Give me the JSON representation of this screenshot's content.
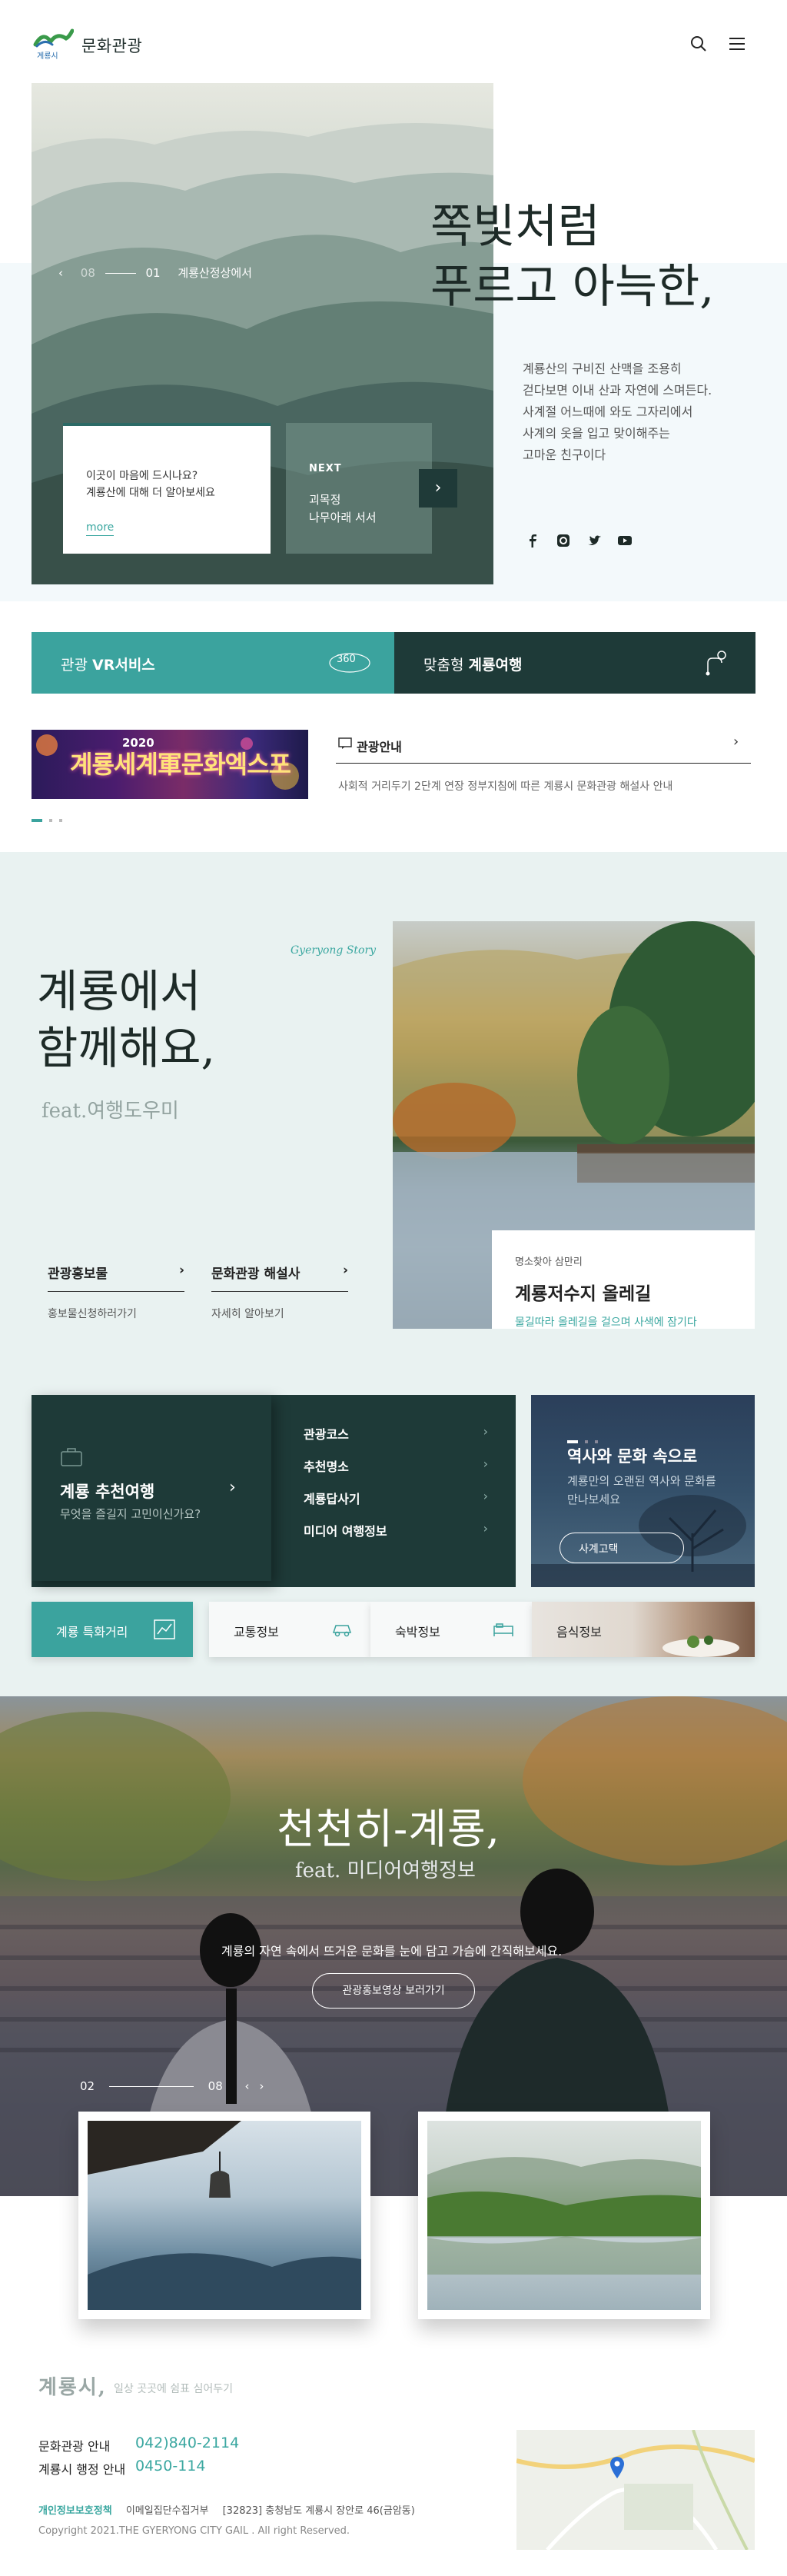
{
  "header": {
    "logo_small": "계룡시",
    "logo_text": "문화관광"
  },
  "hero": {
    "page_current": "08",
    "page_index": "01",
    "slide_title": "계룡산정상에서",
    "card_text_1": "이곳이 마음에 드시나요?",
    "card_text_2": "계룡산에 대해 더 알아보세요",
    "card_more": "more",
    "next_label": "NEXT",
    "next_line_1": "괴목정",
    "next_line_2": "나무아래 서서",
    "title_line_1": "쪽빛처럼",
    "title_line_2": "푸르고 아늑한,",
    "desc": [
      "계룡산의 구비진 산맥을 조용히",
      "걷다보면 이내 산과 자연에 스며든다.",
      "사계절 어느때에 와도 그자리에서",
      "사계의 옷을 입고 맞이해주는",
      "고마운 친구이다"
    ]
  },
  "banners": {
    "vr_prefix": "관광",
    "vr_strong": "VR서비스",
    "vr_badge": "360",
    "travel_prefix": "맞춤형",
    "travel_strong": "계룡여행"
  },
  "notice": {
    "festival_year": "2020",
    "festival_text": "계룡세계軍문화엑스포",
    "title": "관광안내",
    "text": "사회적 거리두기 2단계 연장 정부지침에 따른 계룡시 문화관광 해설사 안내"
  },
  "story": {
    "tag": "Gyeryong Story",
    "title_line_1": "계룡에서",
    "title_line_2": "함께해요,",
    "feat": "feat.여행도우미",
    "link_1": "관광홍보물",
    "link_1_sub": "홍보물신청하러가기",
    "link_2": "문화관광 해설사",
    "link_2_sub": "자세히 알아보기",
    "card_small": "명소찾아 삼만리",
    "card_title": "계룡저수지 올레길",
    "card_desc": "물길따라 올레길을 걸으며 사색에 잠기다"
  },
  "recommend": {
    "title": "계룡 추천여행",
    "sub": "무엇을 즐길지 고민이신가요?",
    "menu": [
      "관광코스",
      "추천명소",
      "계룡답사기",
      "미디어 여행정보"
    ]
  },
  "history": {
    "title": "역사와 문화 속으로",
    "desc": "계룡만의 오랜된 역사와 문화를 만나보세요",
    "button": "사계고택"
  },
  "tiles": [
    "계룡 특화거리",
    "교통정보",
    "숙박정보",
    "음식정보"
  ],
  "slow": {
    "title": "천천히-계룡,",
    "feat": "feat. 미디어여행정보",
    "desc": "계룡의 자연 속에서 뜨거운 문화를 눈에 담고 가슴에 간직해보세요.",
    "button": "관광홍보영상 보러가기",
    "page_current": "02",
    "page_total": "08"
  },
  "footer": {
    "brand": "계룡시,",
    "brand_sub": "일상 곳곳에 쉼표 심어두기",
    "tour_label": "문화관광 안내",
    "tour_phone": "042)840-2114",
    "admin_label": "계룡시 행정 안내",
    "admin_phone": "0450-114",
    "privacy": "개인정보보호정책",
    "email_policy": "이메일집단수집거부",
    "address": "[32823] 충청남도 계룡시 장안로 46(금암동)",
    "copyright": "Copyright 2021.THE GYERYONG CITY GAIL . All right Reserved."
  },
  "colors": {
    "accent": "#3ba39e",
    "dark_green": "#1e3a38",
    "story_bg": "#e9f2f1"
  }
}
